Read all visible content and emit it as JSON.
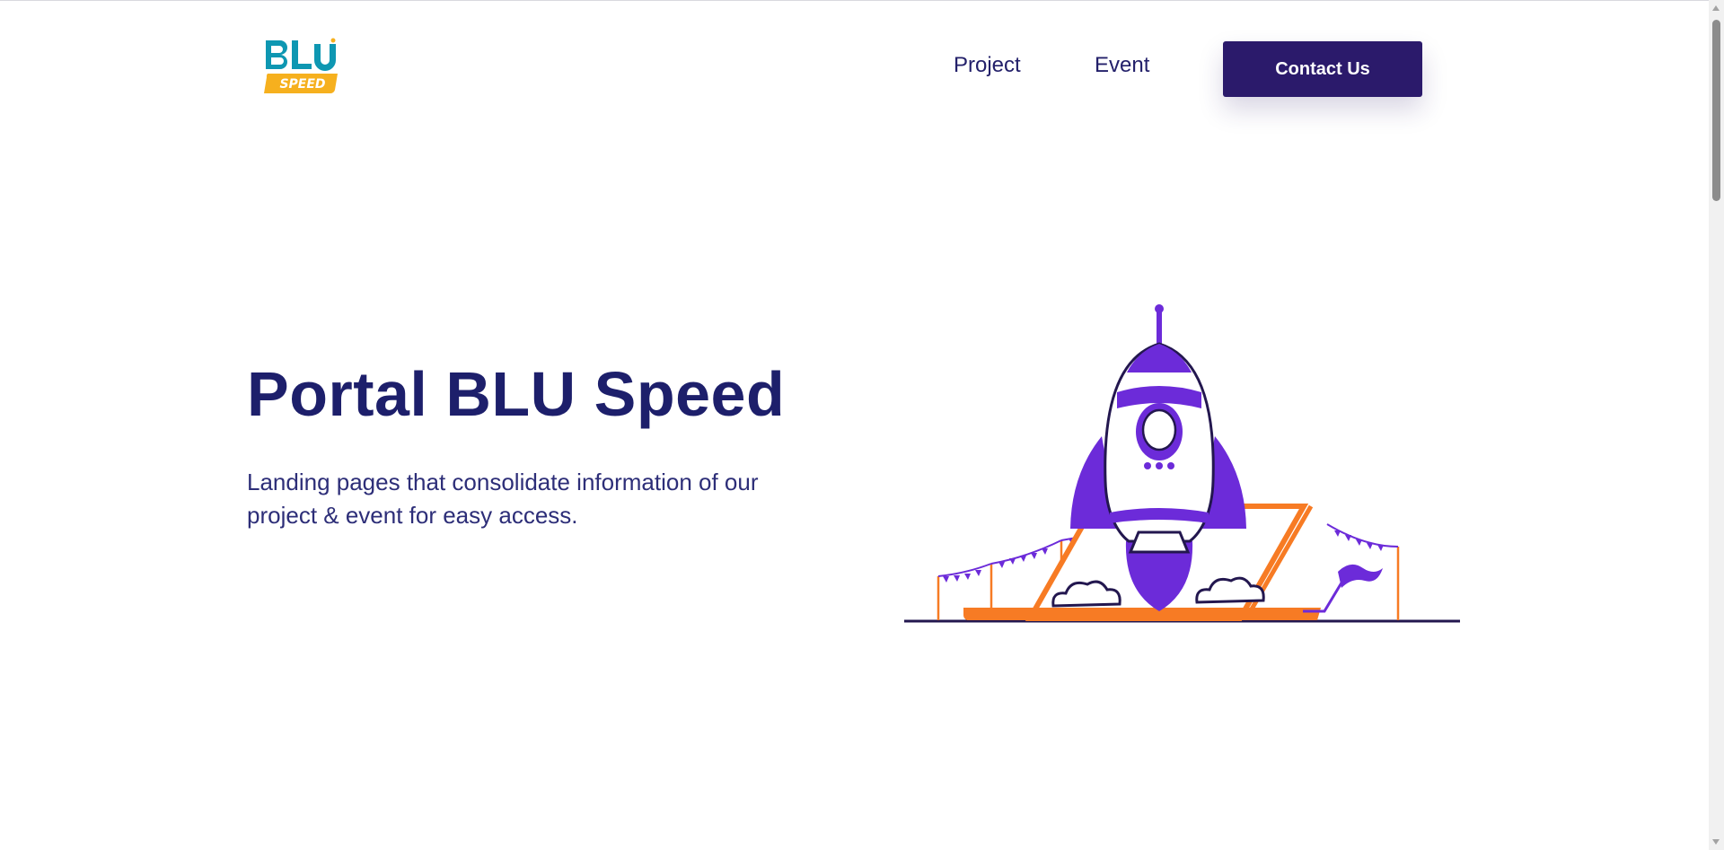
{
  "header": {
    "logo": {
      "text_top": "BLU",
      "text_bottom": "SPEED",
      "primary_color": "#0e97b2",
      "badge_color": "#f6b01e"
    },
    "nav": [
      {
        "label": "Project"
      },
      {
        "label": "Event"
      }
    ],
    "contact_button": {
      "label": "Contact Us",
      "color": "#2b1a6b"
    }
  },
  "hero": {
    "title": "Portal BLU Speed",
    "subtitle": "Landing pages that consolidate information of our project & event for easy access.",
    "illustration": "rocket-launch-illustration"
  },
  "colors": {
    "title": "#1d1f6b",
    "text": "#2d2e78",
    "purple": "#6c2bd9",
    "orange": "#f77b24",
    "outline": "#23174f"
  }
}
